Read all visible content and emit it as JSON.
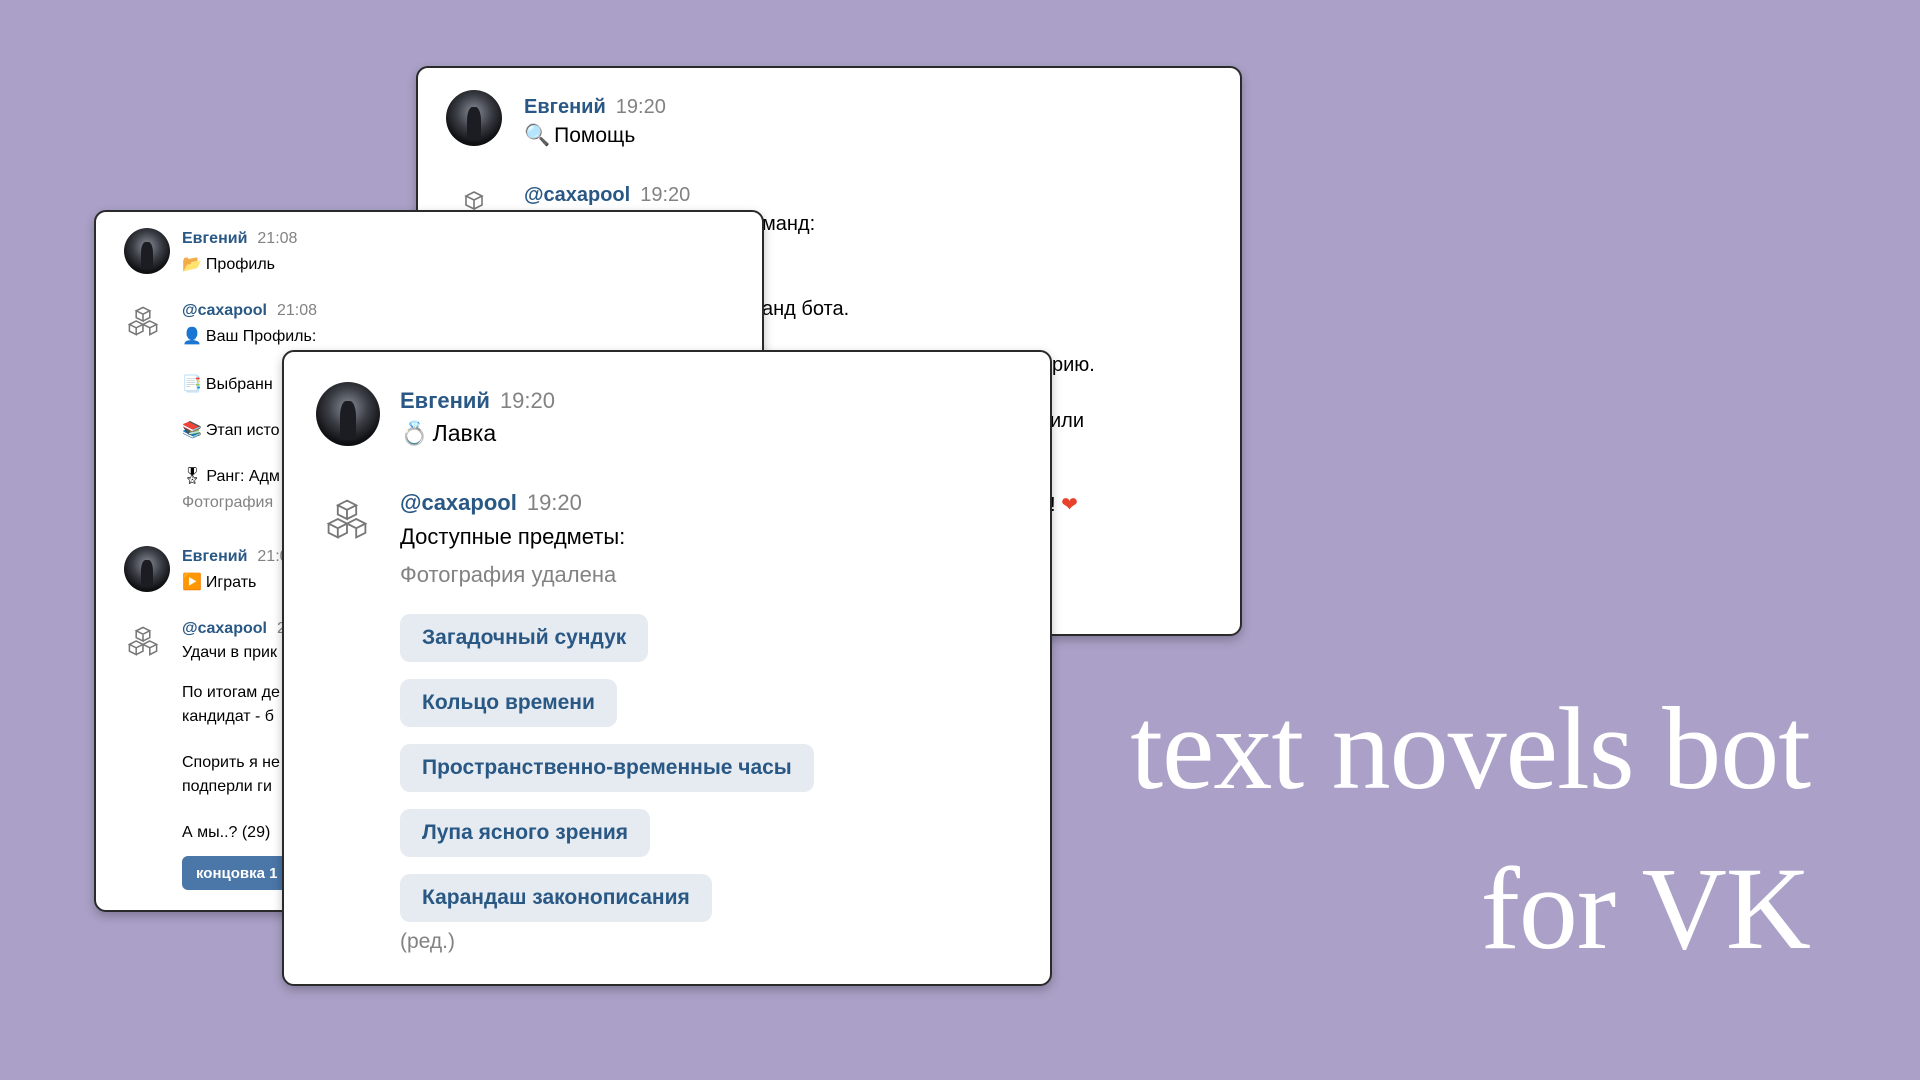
{
  "tagline": {
    "line1": "text novels bot",
    "line2": "for VK"
  },
  "back_card": {
    "msg1": {
      "author": "Евгений",
      "time": "19:20",
      "icon": "magnifier-emoji",
      "text": "Помощь"
    },
    "msg2": {
      "author": "@caxapool",
      "time": "19:20"
    },
    "partial_lines": [
      "манд:",
      "анд бота.",
      "рию.",
      "или",
      "!"
    ],
    "heart": "❤"
  },
  "mid_card": {
    "msg1": {
      "author": "Евгений",
      "time": "21:08",
      "icon": "folder-emoji",
      "text": "Профиль"
    },
    "msg2": {
      "author": "@caxapool",
      "time": "21:08",
      "line1": "Ваш Профиль:",
      "line2": "Выбранн",
      "line3": "Этап исто",
      "line4": "Ранг: Адм",
      "photo": "Фотография"
    },
    "msg3": {
      "author": "Евгений",
      "time": "21:0",
      "icon": "play-emoji",
      "text": "Играть"
    },
    "msg4": {
      "author": "@caxapool",
      "time": "2",
      "line1": "Удачи в прик",
      "line2": "По итогам де",
      "line3": "кандидат - б",
      "line4": "Спорить я не",
      "line5": "подперли ги",
      "line6": "А мы..? (29)",
      "button": "концовка 1"
    }
  },
  "front_card": {
    "msg1": {
      "author": "Евгений",
      "time": "19:20",
      "icon": "ring-emoji",
      "text": "Лавка"
    },
    "msg2": {
      "author": "@caxapool",
      "time": "19:20",
      "text": "Доступные предметы:",
      "photo_removed": "Фотография удалена",
      "edited": "(ред.)"
    },
    "buttons": [
      "Загадочный сундук",
      "Кольцо времени",
      "Пространственно-временные часы",
      "Лупа ясного зрения",
      "Карандаш законописания"
    ]
  },
  "colors": {
    "background": "#aba1c8",
    "link": "#2a5885",
    "button_bg": "#e5ebf1",
    "accent": "#4a76a8"
  }
}
